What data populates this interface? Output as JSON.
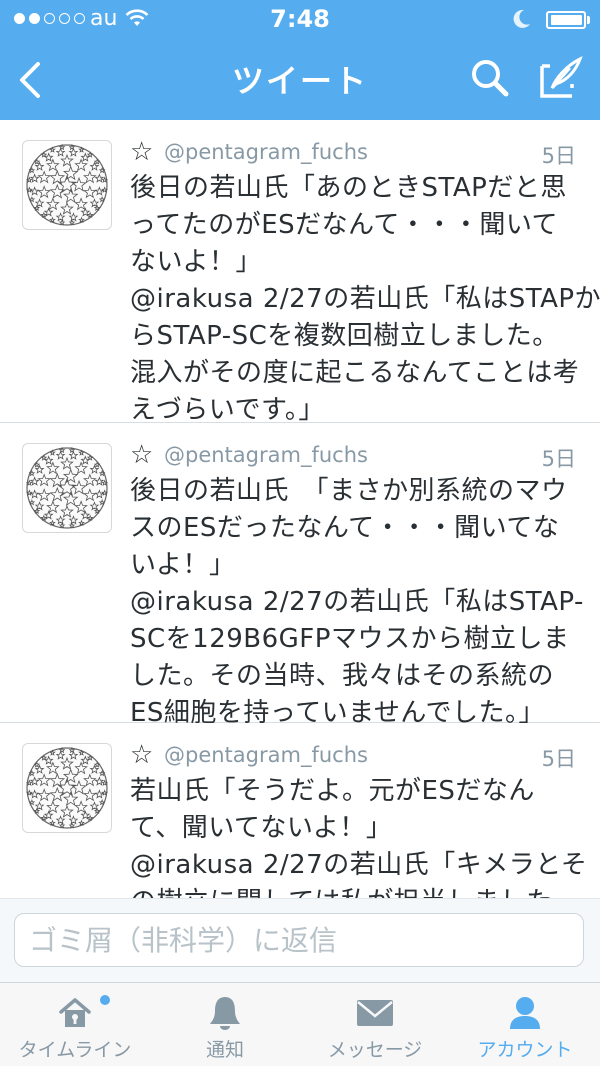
{
  "status_bar": {
    "carrier": "au",
    "time": "7:48"
  },
  "nav": {
    "title": "ツイート",
    "back_icon": "chevron-left-icon",
    "search_icon": "search-icon",
    "compose_icon": "compose-icon"
  },
  "tweets": [
    {
      "handle": "@pentagram_fuchs",
      "time": "5日",
      "text": "後日の若山氏「あのときSTAPだと思\nってたのがESだなんて・・・聞いて\nないよ！」\n@irakusa 2/27の若山氏「私はSTAPか\nらSTAP-SCを複数回樹立しました。\n混入がその度に起こるなんてことは考\nえづらいです。」"
    },
    {
      "handle": "@pentagram_fuchs",
      "time": "5日",
      "text": "後日の若山氏　「まさか別系統のマウ\nスのESだったなんて・・・聞いてな\nいよ！」\n@irakusa 2/27の若山氏「私はSTAP-\nSCを129B6GFPマウスから樹立しま\nした。その当時、我々はその系統の\nES細胞を持っていませんでした。」"
    },
    {
      "handle": "@pentagram_fuchs",
      "time": "5日",
      "text": "若山氏「そうだよ。元がESだなん\nて、聞いてないよ！」\n@irakusa 2/27の若山氏「キメラとそ\nの樹立に関しては私が担当しました。"
    }
  ],
  "reply": {
    "placeholder": "ゴミ屑（非科学）に返信"
  },
  "tabs": [
    {
      "label": "タイムライン",
      "icon": "home-icon",
      "active": false,
      "has_notification_dot": true
    },
    {
      "label": "通知",
      "icon": "bell-icon",
      "active": false
    },
    {
      "label": "メッセージ",
      "icon": "envelope-icon",
      "active": false
    },
    {
      "label": "アカウント",
      "icon": "person-icon",
      "active": true
    }
  ],
  "colors": {
    "brand_blue": "#55acee",
    "text": "#292f33",
    "muted": "#8899a6"
  }
}
